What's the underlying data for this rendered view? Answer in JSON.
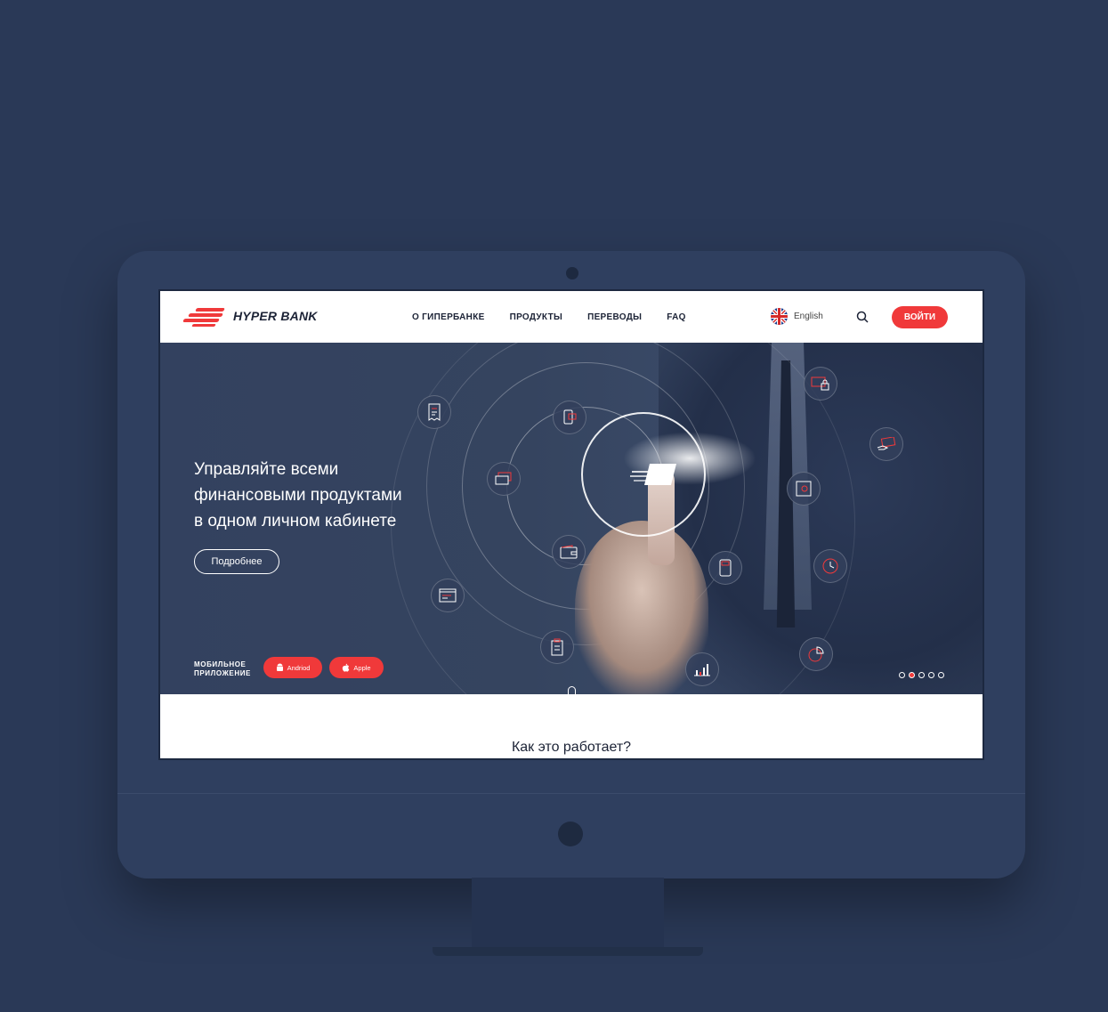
{
  "header": {
    "brand": "HYPER BANK",
    "nav": [
      "О ГИПЕРБАНКЕ",
      "ПРОДУКТЫ",
      "ПЕРЕВОДЫ",
      "FAQ"
    ],
    "language": "English",
    "login_label": "ВОЙТИ"
  },
  "hero": {
    "title_lines": [
      "Управляйте всеми",
      "финансовыми продуктами",
      "в одном личном кабинете"
    ],
    "more_label": "Подробнее",
    "app_label_line1": "МОБИЛЬНОЕ",
    "app_label_line2": "ПРИЛОЖЕНИЕ",
    "android_label": "Andriod",
    "apple_label": "Apple",
    "slides_total": 5,
    "active_slide": 2
  },
  "section": {
    "title": "Как это работает?"
  },
  "colors": {
    "accent": "#f0393a",
    "background": "#2a3957",
    "hero": "#35445f"
  },
  "icons": [
    "receipt-icon",
    "phone-transfer-icon",
    "card-lock-icon",
    "card-hand-icon",
    "credit-cards-icon",
    "safe-icon",
    "wallet-icon",
    "pos-terminal-icon",
    "clock-icon",
    "browser-icon",
    "clipboard-icon",
    "bar-chart-icon",
    "pie-chart-icon"
  ]
}
